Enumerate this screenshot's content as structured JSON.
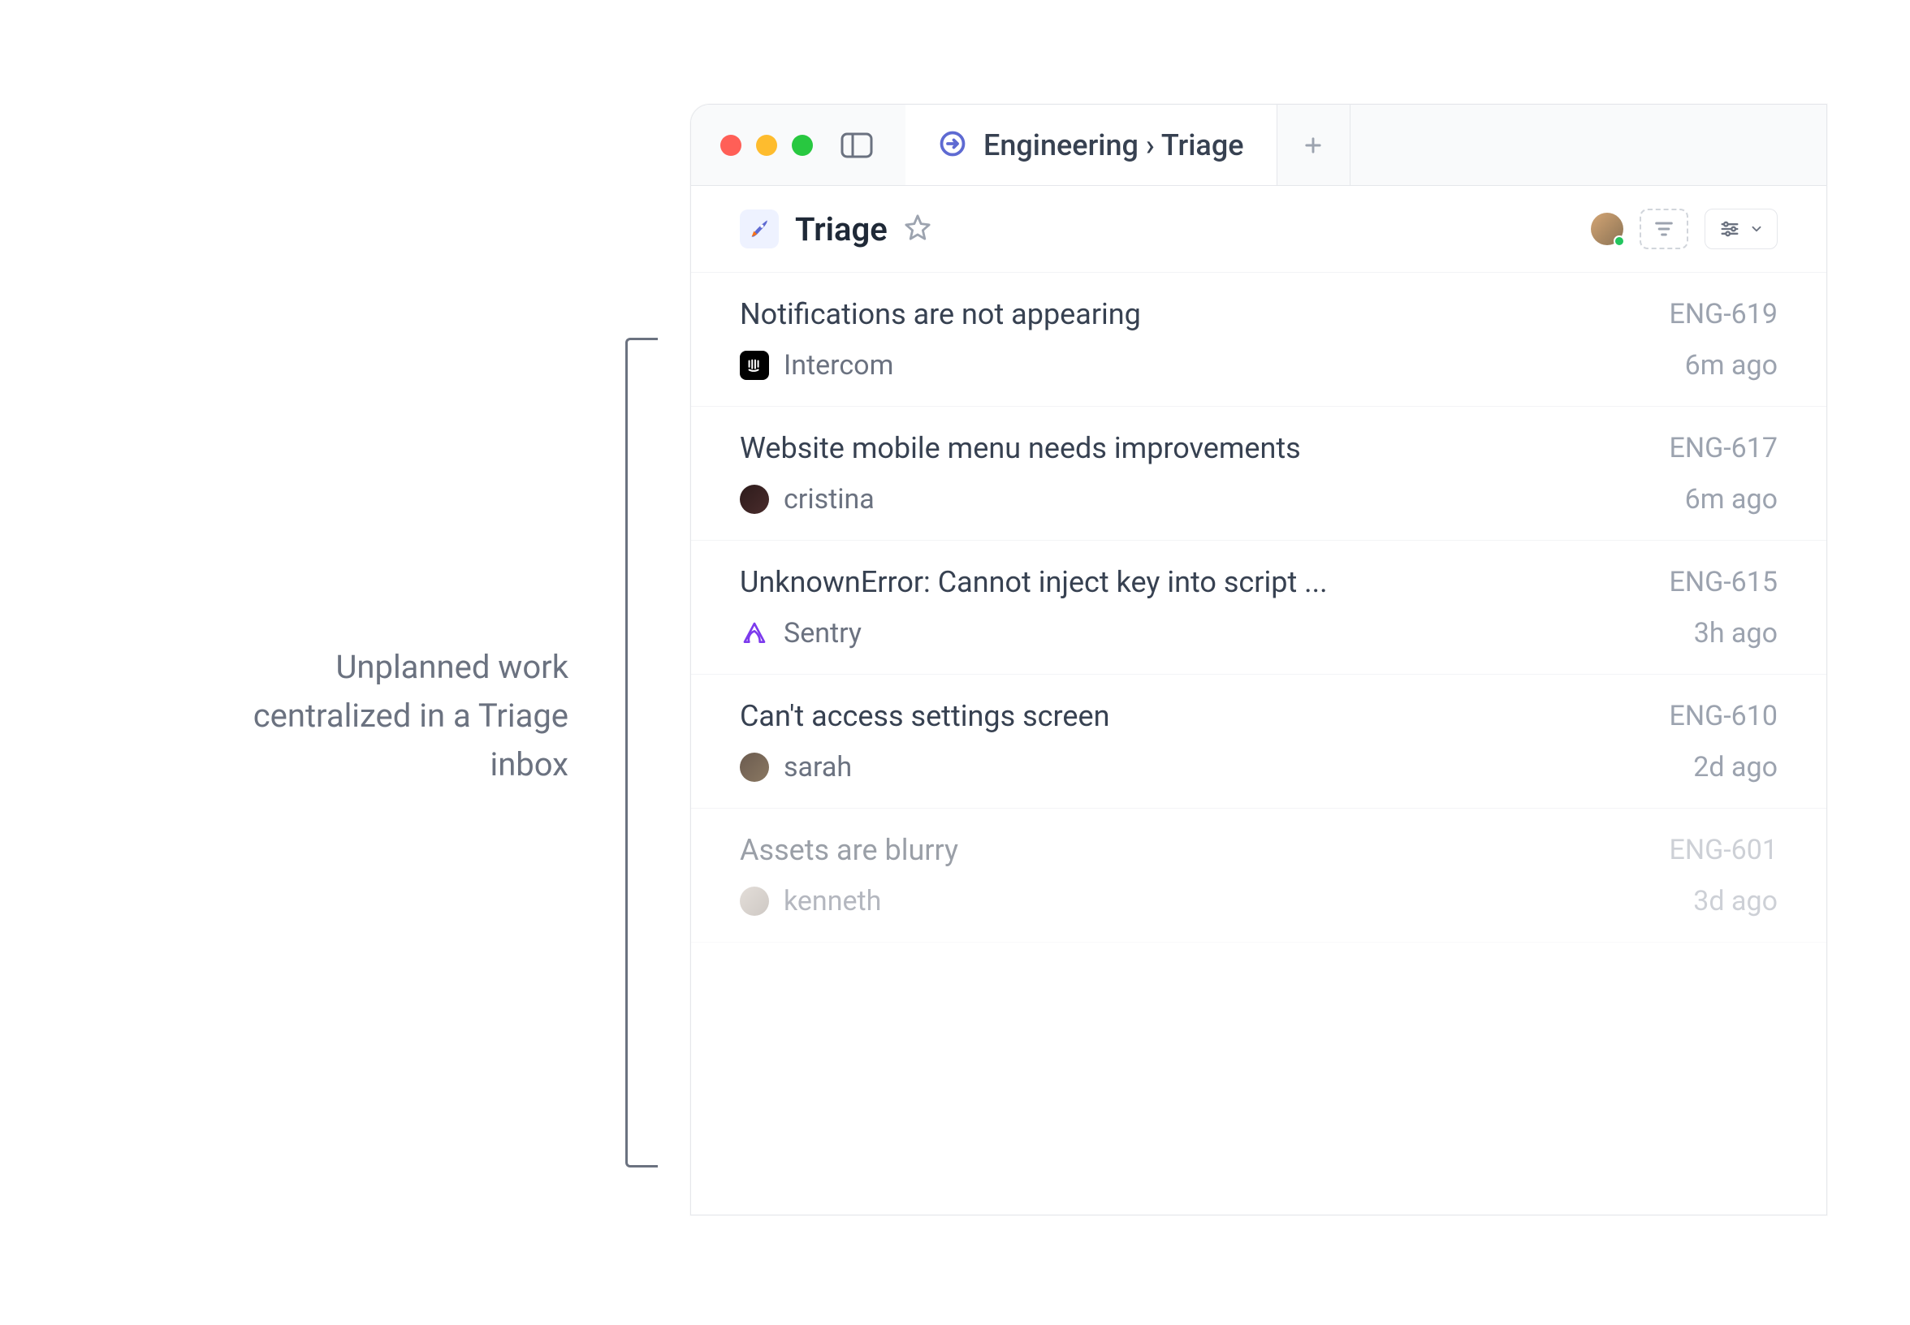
{
  "caption": "Unplanned work centralized in a Triage inbox",
  "breadcrumb": "Engineering › Triage",
  "page_title": "Triage",
  "issues": [
    {
      "title": "Notifications are not appearing",
      "id": "ENG-619",
      "source": "Intercom",
      "source_type": "intercom",
      "time": "6m ago"
    },
    {
      "title": "Website mobile menu needs improvements",
      "id": "ENG-617",
      "source": "cristina",
      "source_type": "avatar1",
      "time": "6m ago"
    },
    {
      "title": "UnknownError: Cannot inject key into script ...",
      "id": "ENG-615",
      "source": "Sentry",
      "source_type": "sentry",
      "time": "3h ago"
    },
    {
      "title": "Can't access settings screen",
      "id": "ENG-610",
      "source": "sarah",
      "source_type": "avatar2",
      "time": "2d ago"
    },
    {
      "title": "Assets are blurry",
      "id": "ENG-601",
      "source": "kenneth",
      "source_type": "avatar3",
      "time": "3d ago"
    }
  ]
}
